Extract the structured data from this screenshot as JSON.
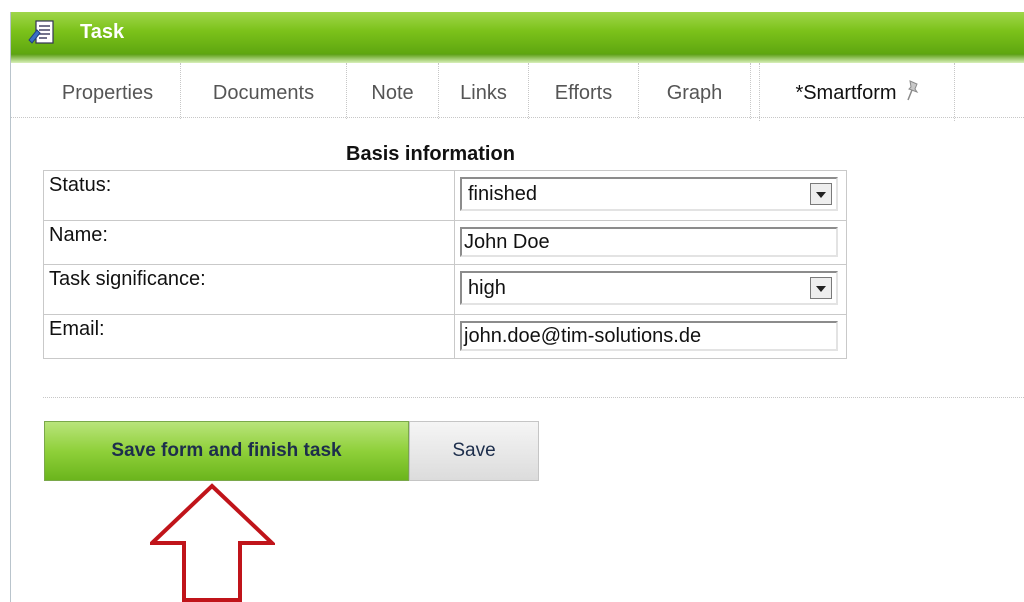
{
  "window": {
    "title": "Task",
    "icon": "task-icon"
  },
  "tabs": [
    {
      "label": "Properties"
    },
    {
      "label": "Documents"
    },
    {
      "label": "Note"
    },
    {
      "label": "Links"
    },
    {
      "label": "Efforts"
    },
    {
      "label": "Graph"
    },
    {
      "label": "*Smartform",
      "active": true,
      "icon": "pin-icon"
    }
  ],
  "form": {
    "section_title": "Basis information",
    "fields": [
      {
        "label": "Status:",
        "type": "select",
        "value": "finished"
      },
      {
        "label": "Name:",
        "type": "text",
        "value": "John Doe"
      },
      {
        "label": "Task significance:",
        "type": "select",
        "value": "high"
      },
      {
        "label": "Email:",
        "type": "text",
        "value": "john.doe@tim-solutions.de"
      }
    ]
  },
  "actions": {
    "primary_label": "Save form and finish task",
    "secondary_label": "Save"
  },
  "colors": {
    "title_bar": "#7cc21a",
    "primary_button": "#8fd03a",
    "arrow": "#c0141a"
  },
  "annotation": {
    "icon": "up-arrow-icon"
  }
}
